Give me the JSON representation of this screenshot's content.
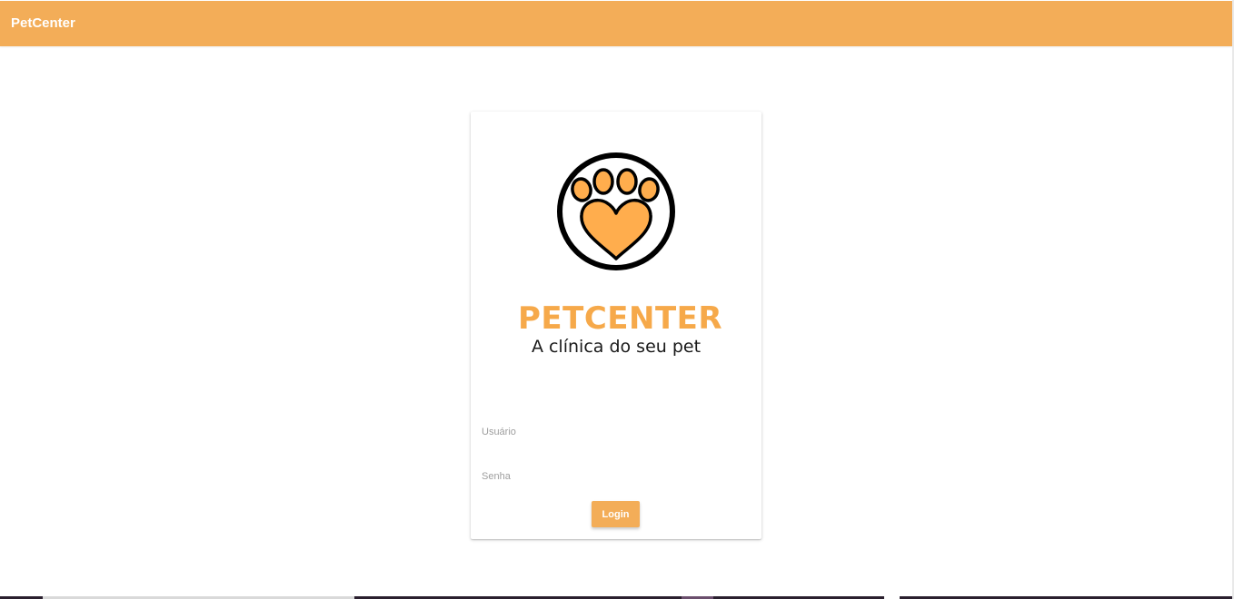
{
  "appbar": {
    "title": "PetCenter"
  },
  "brand": {
    "wordmark": "PETCENTER",
    "tagline": "A clínica do seu pet",
    "logo_icon": "paw-heart-icon"
  },
  "form": {
    "username_label": "Usuário",
    "password_label": "Senha",
    "login_label": "Login"
  },
  "colors": {
    "accent": "#f3ad58",
    "logo_orange": "#ffad4d",
    "logo_outline": "#000000"
  }
}
